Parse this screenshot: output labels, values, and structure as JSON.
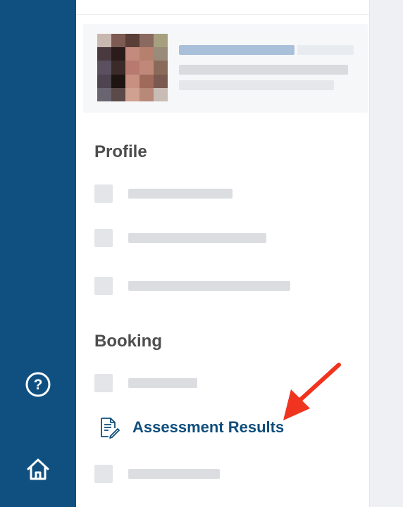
{
  "rail": {
    "help_icon": "question-circle-icon",
    "home_icon": "home-icon",
    "color": "#0f5081"
  },
  "profile_section": {
    "title": "Profile"
  },
  "booking_section": {
    "title": "Booking"
  },
  "active_nav": {
    "label": "Assessment Results",
    "icon": "document-edit-icon",
    "color": "#0f4e7c"
  },
  "annotation": {
    "arrow_color": "#f0341f"
  }
}
